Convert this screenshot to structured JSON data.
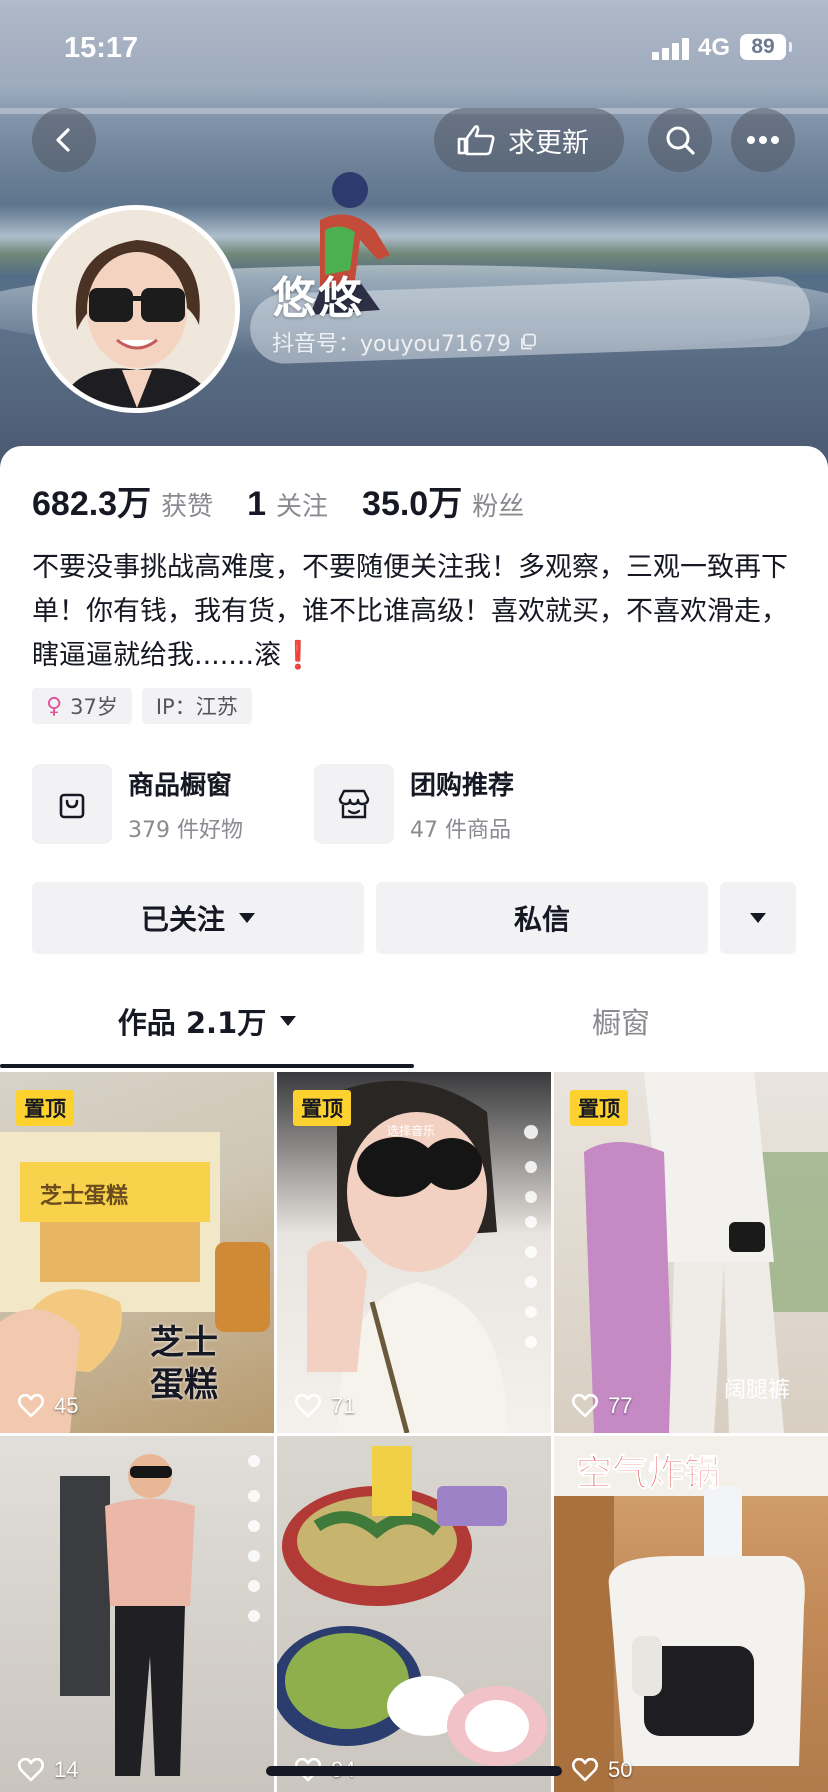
{
  "status_bar": {
    "time": "15:17",
    "network": "4G",
    "battery": "89"
  },
  "header": {
    "update_label": "求更新",
    "nickname": "悠悠",
    "douyin_id": "抖音号：youyou71679"
  },
  "stats": [
    {
      "value": "682.3万",
      "label": "获赞"
    },
    {
      "value": "1",
      "label": "关注"
    },
    {
      "value": "35.0万",
      "label": "粉丝"
    }
  ],
  "bio": {
    "text": "不要没事挑战高难度，不要随便关注我！多观察，三观一致再下单！你有钱，我有货，谁不比谁高级！喜欢就买，不喜欢滑走，瞎逼逼就给我.......滚",
    "mark": "❗"
  },
  "tags": {
    "age": "37岁",
    "female_symbol": "♀",
    "ip": "IP：江苏"
  },
  "shops": [
    {
      "title": "商品橱窗",
      "subtitle": "379 件好物",
      "icon": "shopping-bag-icon"
    },
    {
      "title": "团购推荐",
      "subtitle": "47 件商品",
      "icon": "store-icon"
    }
  ],
  "actions": {
    "followed": "已关注",
    "message": "私信"
  },
  "tabs": {
    "works": "作品 2.1万",
    "window": "橱窗"
  },
  "videos": [
    {
      "pinned": "置顶",
      "likes": "45",
      "overlay": "芝士蛋糕",
      "top_text": "芝士蛋糕"
    },
    {
      "pinned": "置顶",
      "likes": "71",
      "overlay": "选择音乐"
    },
    {
      "pinned": "置顶",
      "likes": "77",
      "overlay": "阔腿裤"
    },
    {
      "pinned": "",
      "likes": "14",
      "overlay": ""
    },
    {
      "pinned": "",
      "likes": "94",
      "overlay": ""
    },
    {
      "pinned": "",
      "likes": "50",
      "overlay": "空气炸锅"
    }
  ],
  "colors": {
    "accent_yellow": "#fdd22e",
    "text_primary": "#161823",
    "text_secondary": "#8a8b91",
    "chip_bg": "#f2f2f4"
  }
}
